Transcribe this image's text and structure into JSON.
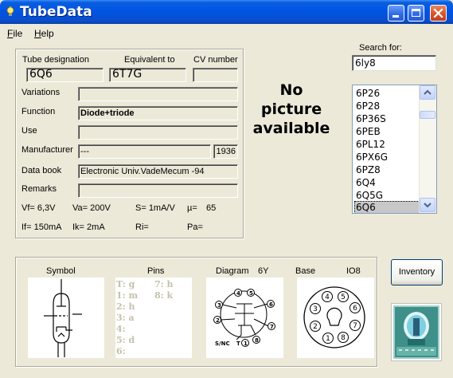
{
  "window": {
    "title": "TubeData"
  },
  "menu": {
    "file": {
      "accel": "F",
      "rest": "ile"
    },
    "help": {
      "accel": "H",
      "rest": "elp"
    }
  },
  "search": {
    "label": "Search for:",
    "value": "6ly8"
  },
  "tube": {
    "designation_label": "Tube designation",
    "designation": "6Q6",
    "equivalent_label": "Equivalent to",
    "equivalent": "6T7G",
    "cv_label": "CV number",
    "cv": "",
    "variations_label": "Variations",
    "variations": "",
    "function_label": "Function",
    "function": "Diode+triode",
    "use_label": "Use",
    "use": "",
    "manufacturer_label": "Manufacturer",
    "manufacturer": "---",
    "year": "1936",
    "databook_label": "Data book",
    "databook": "Electronic Univ.VadeMecum -94",
    "remarks_label": "Remarks",
    "remarks": ""
  },
  "params": {
    "vf": "Vf= 6,3V",
    "va": "Va= 200V",
    "s": "S= 1mA/V",
    "mu": "µ=",
    "mu_val": "65",
    "if": "If= 150mA",
    "ik": "Ik=  2mA",
    "ri": "Ri=",
    "pa": "Pa="
  },
  "no_picture": [
    "No",
    "picture",
    "available"
  ],
  "tube_list": [
    "6P26",
    "6P28",
    "6P36S",
    "6PEB",
    "6PL12",
    "6PX6G",
    "6PZ8",
    "6Q4",
    "6Q5G",
    "6Q6"
  ],
  "tube_list_selected": "6Q6",
  "bottom": {
    "symbol_label": "Symbol",
    "pins_label": "Pins",
    "diagram_label": "Diagram",
    "diagram_code": "6Y",
    "base_label": "Base",
    "base_code": "IO8",
    "pins_col1": [
      "T: g",
      "1: m",
      "2: h",
      "3: a",
      "4:",
      "5: d",
      "6:"
    ],
    "pins_col2": [
      "7: h",
      "8: k"
    ],
    "diagram_text": {
      "p1": "1",
      "p2": "2",
      "p3": "3",
      "p4": "4",
      "p5": "5",
      "p6": "6",
      "p7": "7",
      "p8": "8",
      "snc": "S/NC",
      "t": "T"
    },
    "base_pins": [
      "1",
      "2",
      "3",
      "4",
      "5",
      "6",
      "7",
      "8"
    ]
  },
  "inventory_label": "Inventory",
  "colors": {
    "titlebar": "#0054e3",
    "window_bg": "#ece9d8",
    "list_selection": "#c8c8c8",
    "pin_text": "#c5c1a8"
  }
}
